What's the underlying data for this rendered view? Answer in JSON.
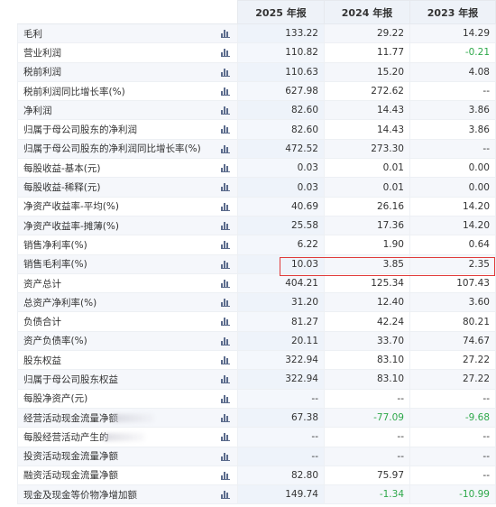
{
  "header": {
    "col_2025": "2025 年报",
    "col_2024": "2024 年报",
    "col_2023": "2023 年报"
  },
  "rows": [
    {
      "name": "毛利",
      "y2025": "133.22",
      "y2024": "29.22",
      "y2023": "14.29"
    },
    {
      "name": "营业利润",
      "y2025": "110.82",
      "y2024": "11.77",
      "y2023": "-0.21"
    },
    {
      "name": "税前利润",
      "y2025": "110.63",
      "y2024": "15.20",
      "y2023": "4.08"
    },
    {
      "name": "税前利润同比增长率(%)",
      "y2025": "627.98",
      "y2024": "272.62",
      "y2023": "--"
    },
    {
      "name": "净利润",
      "y2025": "82.60",
      "y2024": "14.43",
      "y2023": "3.86"
    },
    {
      "name": "归属于母公司股东的净利润",
      "y2025": "82.60",
      "y2024": "14.43",
      "y2023": "3.86"
    },
    {
      "name": "归属于母公司股东的净利润同比增长率(%)",
      "y2025": "472.52",
      "y2024": "273.30",
      "y2023": "--"
    },
    {
      "name": "每股收益-基本(元)",
      "y2025": "0.03",
      "y2024": "0.01",
      "y2023": "0.00"
    },
    {
      "name": "每股收益-稀释(元)",
      "y2025": "0.03",
      "y2024": "0.01",
      "y2023": "0.00"
    },
    {
      "name": "净资产收益率-平均(%)",
      "y2025": "40.69",
      "y2024": "26.16",
      "y2023": "14.20"
    },
    {
      "name": "净资产收益率-摊薄(%)",
      "y2025": "25.58",
      "y2024": "17.36",
      "y2023": "14.20"
    },
    {
      "name": "销售净利率(%)",
      "y2025": "6.22",
      "y2024": "1.90",
      "y2023": "0.64"
    },
    {
      "name": "销售毛利率(%)",
      "y2025": "10.03",
      "y2024": "3.85",
      "y2023": "2.35"
    },
    {
      "name": "资产总计",
      "y2025": "404.21",
      "y2024": "125.34",
      "y2023": "107.43"
    },
    {
      "name": "总资产净利率(%)",
      "y2025": "31.20",
      "y2024": "12.40",
      "y2023": "3.60"
    },
    {
      "name": "负债合计",
      "y2025": "81.27",
      "y2024": "42.24",
      "y2023": "80.21"
    },
    {
      "name": "资产负债率(%)",
      "y2025": "20.11",
      "y2024": "33.70",
      "y2023": "74.67"
    },
    {
      "name": "股东权益",
      "y2025": "322.94",
      "y2024": "83.10",
      "y2023": "27.22"
    },
    {
      "name": "归属于母公司股东权益",
      "y2025": "322.94",
      "y2024": "83.10",
      "y2023": "27.22"
    },
    {
      "name": "每股净资产(元)",
      "y2025": "--",
      "y2024": "--",
      "y2023": "--"
    },
    {
      "name": "经营活动现金流量净额",
      "y2025": "67.38",
      "y2024": "-77.09",
      "y2023": "-9.68"
    },
    {
      "name": "每股经营活动产生的",
      "y2025": "--",
      "y2024": "--",
      "y2023": "--"
    },
    {
      "name": "投资活动现金流量净额",
      "y2025": "--",
      "y2024": "--",
      "y2023": "--"
    },
    {
      "name": "融资活动现金流量净额",
      "y2025": "82.80",
      "y2024": "75.97",
      "y2023": "--"
    },
    {
      "name": "现金及现金等价物净增加额",
      "y2025": "149.74",
      "y2024": "-1.34",
      "y2023": "-10.99"
    }
  ],
  "icon": "bar-chart-icon",
  "colors": {
    "negative": "#2ea84a",
    "highlight_border": "#e03a3a"
  }
}
